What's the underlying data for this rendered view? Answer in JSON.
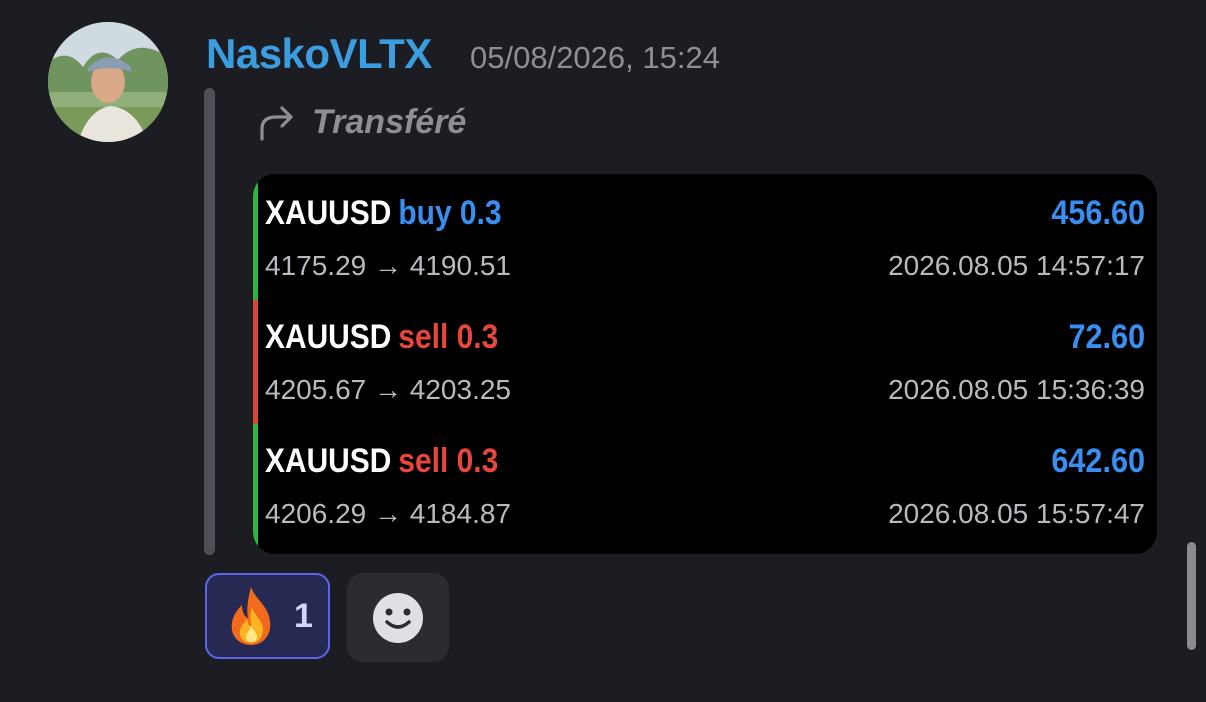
{
  "message": {
    "username": "NaskoVLTX",
    "timestamp": "05/08/2026, 15:24",
    "forward_label": "Transféré",
    "arrow_glyph": "→",
    "trades": [
      {
        "symbol": "XAUUSD",
        "side": "buy",
        "volume": "0.3",
        "profit": "456.60",
        "open_price": "4175.29",
        "close_price": "4190.51",
        "time": "2026.08.05 14:57:17",
        "side_color": "#3a8ef0",
        "stripe_color": "#2fb344"
      },
      {
        "symbol": "XAUUSD",
        "side": "sell",
        "volume": "0.3",
        "profit": "72.60",
        "open_price": "4205.67",
        "close_price": "4203.25",
        "time": "2026.08.05 15:36:39",
        "side_color": "#e8463c",
        "stripe_color": "#d8453a"
      },
      {
        "symbol": "XAUUSD",
        "side": "sell",
        "volume": "0.3",
        "profit": "642.60",
        "open_price": "4206.29",
        "close_price": "4184.87",
        "time": "2026.08.05 15:57:47",
        "side_color": "#e8463c",
        "stripe_color": "#2fb344"
      }
    ]
  },
  "reactions": [
    {
      "icon": "fire-emoji",
      "count": "1",
      "selected": true
    }
  ],
  "add_reaction": {
    "icon": "smiley-icon"
  },
  "colors": {
    "background": "#1c1d22",
    "username": "#3b9de0",
    "profit": "#3a8ef0",
    "reaction_border": "#5b65ea"
  }
}
